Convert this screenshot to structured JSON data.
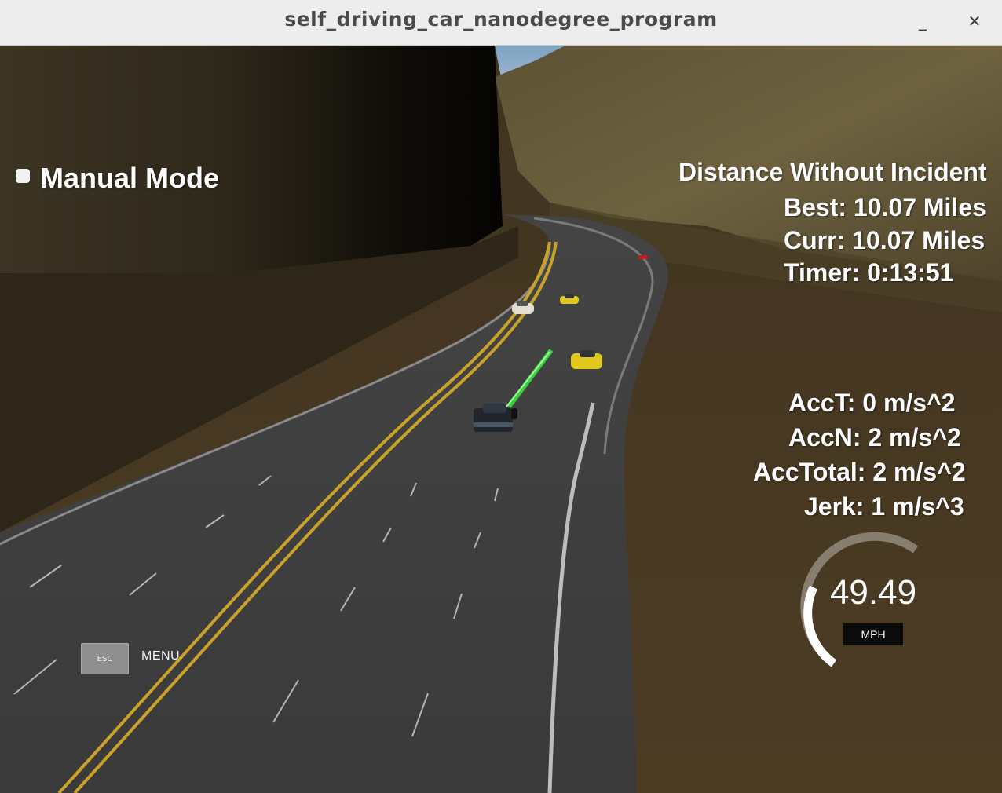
{
  "window": {
    "title": "self_driving_car_nanodegree_program",
    "minimize_glyph": "_",
    "close_glyph": "✕"
  },
  "hud": {
    "mode_label": "Manual Mode",
    "distance_title": "Distance Without Incident",
    "best": "Best: 10.07 Miles",
    "curr": "Curr: 10.07 Miles",
    "timer": "Timer: 0:13:51",
    "acc_t": "AccT: 0 m/s^2",
    "acc_n": "AccN: 2 m/s^2",
    "acc_total": "AccTotal: 2 m/s^2",
    "jerk": "Jerk: 1 m/s^3"
  },
  "speedometer": {
    "value": "49.49",
    "unit": "MPH"
  },
  "menu": {
    "key_label": "ESC",
    "label": "MENU"
  },
  "colors": {
    "path_line": "#3ccf3c",
    "lane_line_yellow": "#c9a22a",
    "npc_car_yellow": "#e0c81c",
    "npc_car_red": "#c21d1d"
  },
  "icons": [
    "checkbox-icon",
    "speed-gauge-icon"
  ]
}
